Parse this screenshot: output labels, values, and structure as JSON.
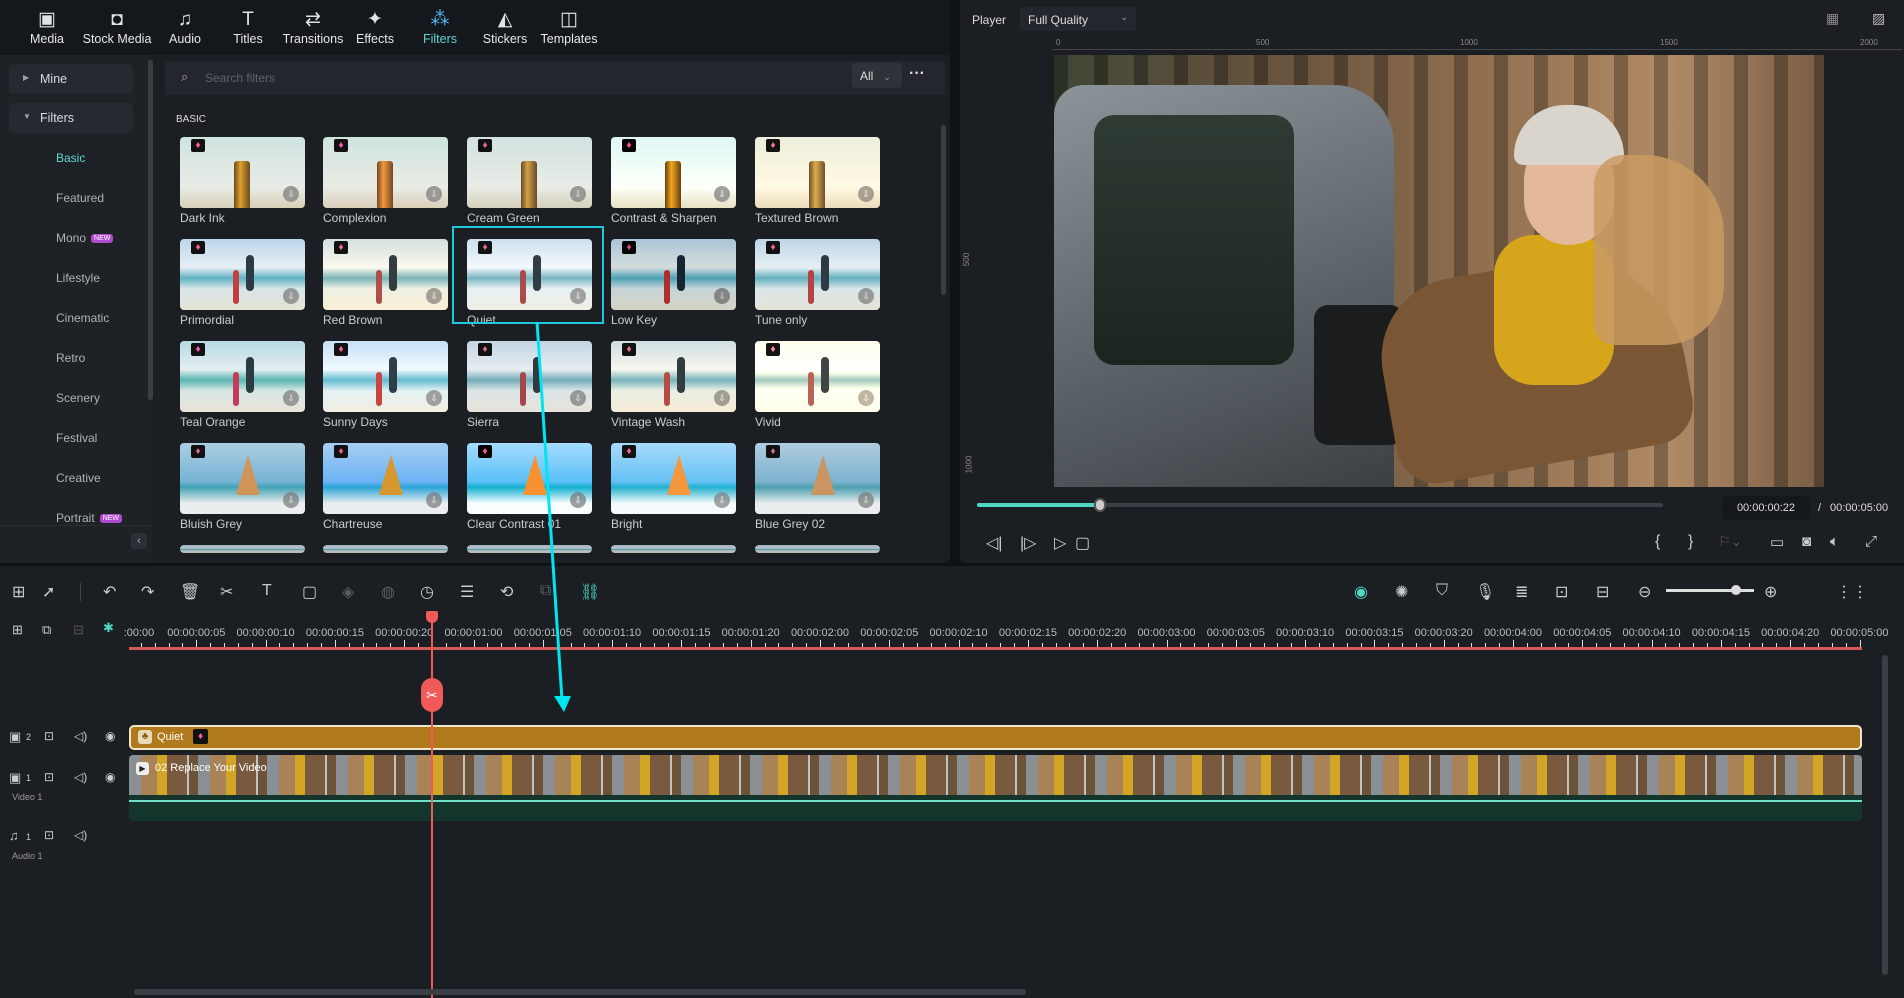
{
  "nav": [
    {
      "label": "Media",
      "icon": "media-icon"
    },
    {
      "label": "Stock Media",
      "icon": "stock-media-icon"
    },
    {
      "label": "Audio",
      "icon": "music-note-icon"
    },
    {
      "label": "Titles",
      "icon": "title-t-icon"
    },
    {
      "label": "Transitions",
      "icon": "transitions-icon"
    },
    {
      "label": "Effects",
      "icon": "effects-star-icon"
    },
    {
      "label": "Filters",
      "icon": "filters-icon",
      "active": true
    },
    {
      "label": "Stickers",
      "icon": "stickers-icon"
    },
    {
      "label": "Templates",
      "icon": "templates-icon"
    }
  ],
  "sidebar": {
    "mine": "Mine",
    "filters": "Filters",
    "items": [
      "Basic",
      "Featured",
      "Mono",
      "Lifestyle",
      "Cinematic",
      "Retro",
      "Scenery",
      "Festival",
      "Creative",
      "Portrait"
    ],
    "new_badge": "NEW"
  },
  "search": {
    "placeholder": "Search filters",
    "filter_value": "All"
  },
  "section": "BASIC",
  "filters": [
    "Dark Ink",
    "Complexion",
    "Cream Green",
    "Contrast & Sharpen",
    "Textured Brown",
    "Primordial",
    "Red Brown",
    "Quiet",
    "Low Key",
    "Tune only",
    "Teal Orange",
    "Sunny Days",
    "Sierra",
    "Vintage Wash",
    "Vivid",
    "Bluish Grey",
    "Chartreuse",
    "Clear Contrast 01",
    "Bright",
    "Blue Grey 02"
  ],
  "selected_filter": "Quiet",
  "player": {
    "label": "Player",
    "quality": "Full Quality",
    "ruler": [
      "0",
      "500",
      "1000",
      "1500",
      "2000"
    ],
    "vruler": [
      "500",
      "1000"
    ],
    "current_time": "00:00:00:22",
    "separator": "/",
    "total_time": "00:00:05:00",
    "progress_fraction": 0.18
  },
  "timeline": {
    "ruler": [
      ":00:00",
      "00:00:00:05",
      "00:00:00:10",
      "00:00:00:15",
      "00:00:00:20",
      "00:00:01:00",
      "00:00:01:05",
      "00:00:01:10",
      "00:00:01:15",
      "00:00:01:20",
      "00:00:02:00",
      "00:00:02:05",
      "00:00:02:10",
      "00:00:02:15",
      "00:00:02:20",
      "00:00:03:00",
      "00:00:03:05",
      "00:00:03:10",
      "00:00:03:15",
      "00:00:03:20",
      "00:00:04:00",
      "00:00:04:05",
      "00:00:04:10",
      "00:00:04:15",
      "00:00:04:20",
      "00:00:05:00"
    ],
    "tracks": {
      "t2_num": "2",
      "t1_num": "1",
      "video_label": "Video 1",
      "a1_num": "1",
      "audio_label": "Audio 1"
    },
    "filter_clip": "Quiet",
    "video_clip": "02 Replace Your Video",
    "zoom_fraction": 0.8
  },
  "colors": {
    "accent": "#5fd6d1",
    "playhead": "#f05a5a",
    "filter_clip": "#b07a1c",
    "arrow": "#00e5f0"
  }
}
